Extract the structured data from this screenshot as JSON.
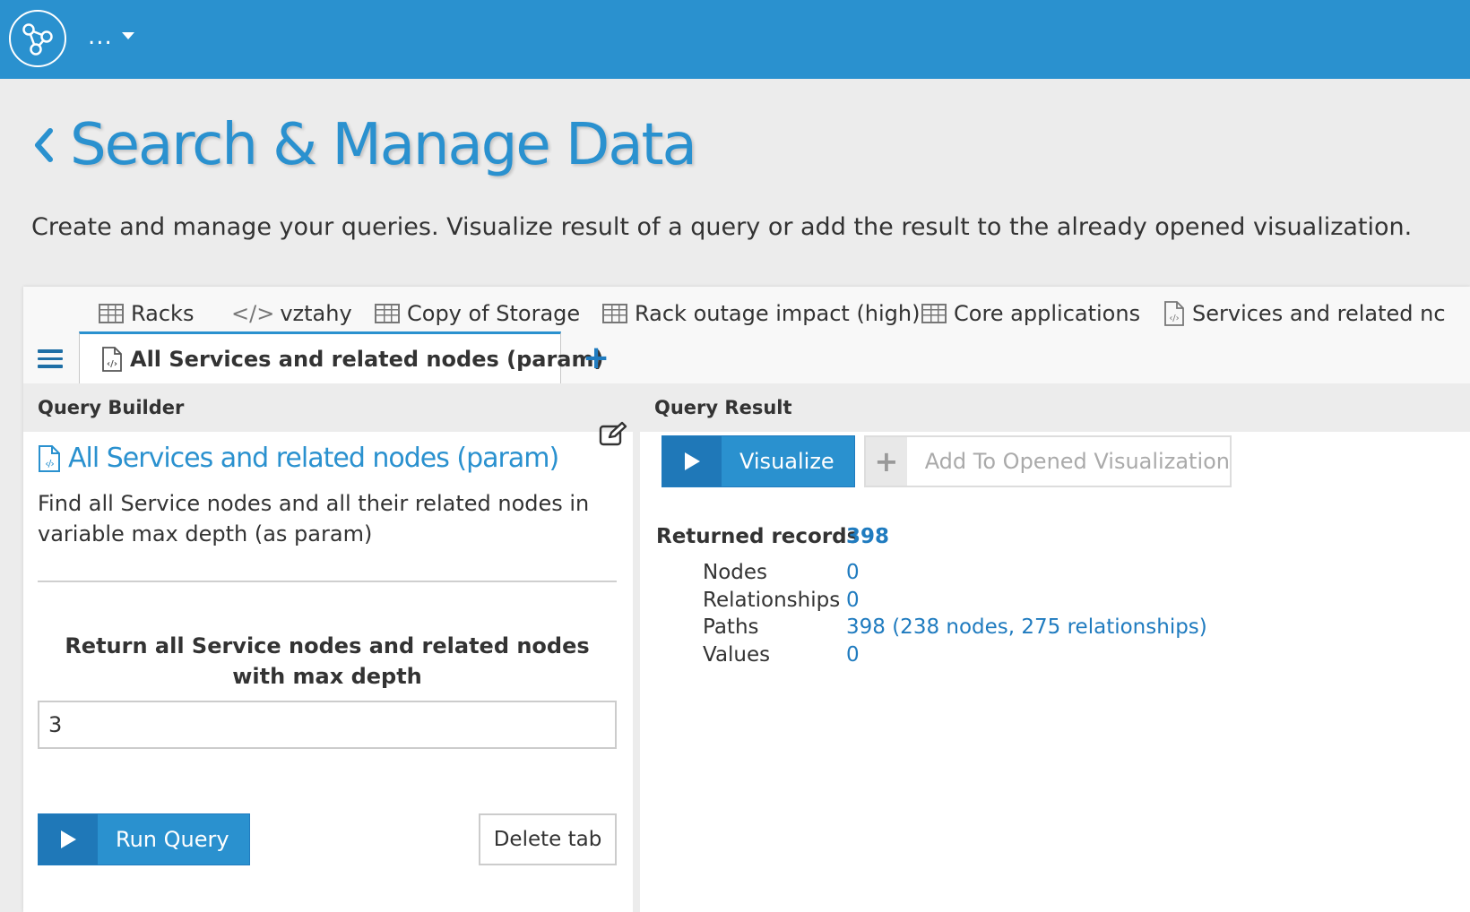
{
  "topbar": {
    "menu_label": "...",
    "logo_icon": "graph-nodes-icon"
  },
  "page": {
    "title": "Search & Manage Data",
    "subtitle": "Create and manage your queries. Visualize result of a query or add the result to the already opened visualization."
  },
  "tabs": {
    "items": [
      {
        "label": "Racks",
        "icon": "table-icon"
      },
      {
        "label": "vztahy",
        "icon": "code-icon"
      },
      {
        "label": "Copy of Storage",
        "icon": "table-icon"
      },
      {
        "label": "Rack outage impact (high)",
        "icon": "table-icon"
      },
      {
        "label": "Core applications",
        "icon": "table-icon"
      },
      {
        "label": "Services and related nc",
        "icon": "code-file-icon"
      }
    ],
    "active": {
      "label": "All Services and related nodes (param)",
      "icon": "code-file-icon"
    },
    "add_label": "+"
  },
  "query_builder": {
    "header": "Query Builder",
    "query_title": "All Services and related nodes (param)",
    "description": "Find all Service nodes and all their related nodes in variable max depth (as param)",
    "param_label": "Return all Service nodes and related nodes with max depth",
    "param_value": "3",
    "run_label": "Run Query",
    "delete_label": "Delete tab"
  },
  "query_result": {
    "header": "Query Result",
    "visualize_label": "Visualize",
    "add_to_vis_label": "Add To Opened Visualization",
    "returned_label": "Returned records",
    "returned_value": "398",
    "rows": [
      {
        "label": "Nodes",
        "value": "0"
      },
      {
        "label": "Relationships",
        "value": "0"
      },
      {
        "label": "Paths",
        "value": "398 (238 nodes, 275 relationships)"
      },
      {
        "label": "Values",
        "value": "0"
      }
    ]
  },
  "colors": {
    "primary": "#2a91cf",
    "primary_dark": "#1f78b8",
    "link": "#1f7bbf"
  }
}
